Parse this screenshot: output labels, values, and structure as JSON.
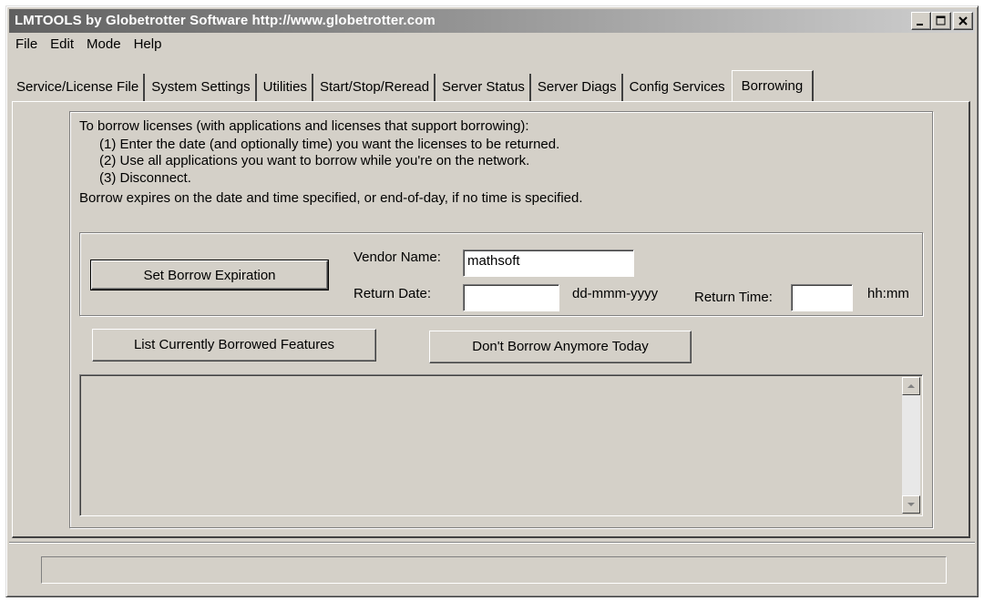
{
  "window": {
    "title": "LMTOOLS by Globetrotter Software http://www.globetrotter.com"
  },
  "menu": [
    "File",
    "Edit",
    "Mode",
    "Help"
  ],
  "tabs": [
    {
      "label": "Service/License File"
    },
    {
      "label": "System Settings"
    },
    {
      "label": "Utilities"
    },
    {
      "label": "Start/Stop/Reread"
    },
    {
      "label": "Server Status"
    },
    {
      "label": "Server Diags"
    },
    {
      "label": "Config Services"
    },
    {
      "label": "Borrowing",
      "active": true
    }
  ],
  "borrowing": {
    "intro": "To borrow licenses (with applications and licenses that support borrowing):",
    "step1": "(1) Enter the date (and optionally time) you want the licenses to be returned.",
    "step2": "(2) Use all applications you want to borrow while you're on the network.",
    "step3": "(3) Disconnect.",
    "expiry_note": "Borrow expires on the date and time specified, or end-of-day, if no time is specified.",
    "set_expiration_button": "Set Borrow Expiration",
    "vendor_label": "Vendor Name:",
    "vendor_value": "mathsoft",
    "return_date_label": "Return Date:",
    "return_date_value": "",
    "date_format": "dd-mmm-yyyy",
    "return_time_label": "Return Time:",
    "return_time_value": "",
    "time_format": "hh:mm",
    "list_button": "List Currently Borrowed Features",
    "dont_borrow_button": "Don't Borrow Anymore Today",
    "output_text": ""
  },
  "status": {
    "text": ""
  },
  "icons": [
    "minimize-icon",
    "maximize-icon",
    "close-icon",
    "scroll-up-icon",
    "scroll-down-icon"
  ]
}
